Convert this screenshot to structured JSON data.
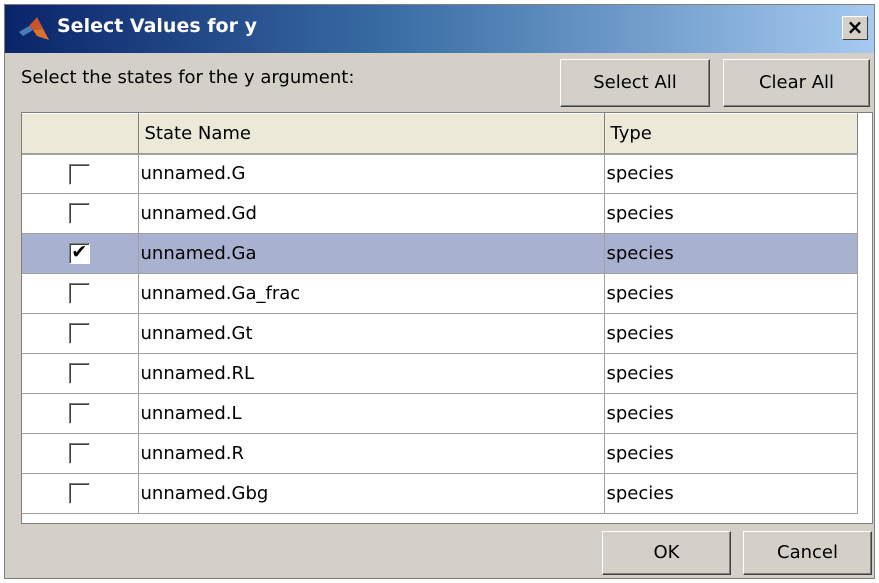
{
  "window": {
    "title": "Select Values for y",
    "close_glyph": "×"
  },
  "prompt": "Select the states for the y argument:",
  "buttons": {
    "select_all": "Select All",
    "clear_all": "Clear All",
    "ok": "OK",
    "cancel": "Cancel"
  },
  "table": {
    "columns": [
      "",
      "State Name",
      "Type"
    ],
    "rows": [
      {
        "checked": false,
        "name": "unnamed.G",
        "type": "species"
      },
      {
        "checked": false,
        "name": "unnamed.Gd",
        "type": "species"
      },
      {
        "checked": true,
        "name": "unnamed.Ga",
        "type": "species"
      },
      {
        "checked": false,
        "name": "unnamed.Ga_frac",
        "type": "species"
      },
      {
        "checked": false,
        "name": "unnamed.Gt",
        "type": "species"
      },
      {
        "checked": false,
        "name": "unnamed.RL",
        "type": "species"
      },
      {
        "checked": false,
        "name": "unnamed.L",
        "type": "species"
      },
      {
        "checked": false,
        "name": "unnamed.R",
        "type": "species"
      },
      {
        "checked": false,
        "name": "unnamed.Gbg",
        "type": "species"
      }
    ]
  },
  "colors": {
    "selected_row": "#a9b1d0",
    "title_gradient_start": "#0a246a",
    "title_gradient_end": "#a6caf0"
  },
  "icons": {
    "app_icon": "matlab-logo-icon",
    "check_mark": "✔"
  }
}
